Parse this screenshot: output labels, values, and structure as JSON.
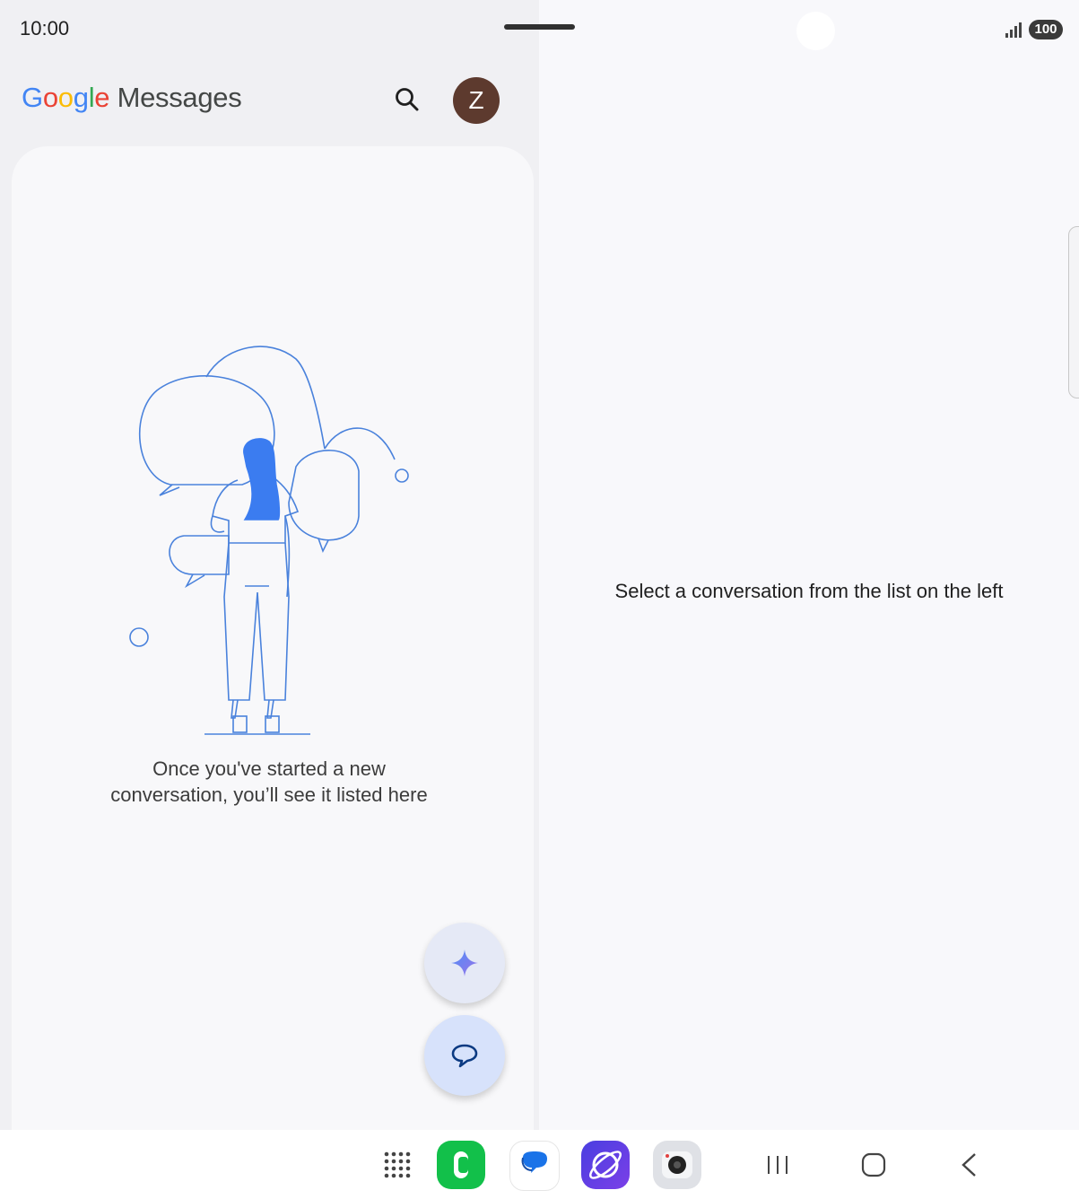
{
  "status_bar": {
    "time": "10:00",
    "battery": "100"
  },
  "header": {
    "logo_letters": [
      "G",
      "o",
      "o",
      "g",
      "l",
      "e"
    ],
    "logo_suffix": "Messages",
    "avatar_letter": "Z",
    "search_icon": "search-icon"
  },
  "conversation_list": {
    "empty_line1": "Once you've started a new",
    "empty_line2": "conversation, you’ll see it listed here"
  },
  "detail_pane": {
    "placeholder": "Select a conversation from the list on the left"
  },
  "fabs": {
    "gemini_icon": "gemini-sparkle-icon",
    "new_chat_icon": "new-chat-icon"
  },
  "taskbar": {
    "apps": [
      "app-drawer-icon",
      "phone-app-icon",
      "messages-app-icon",
      "internet-app-icon",
      "camera-app-icon"
    ],
    "nav": [
      "recents-icon",
      "home-icon",
      "back-icon"
    ]
  },
  "colors": {
    "illustration_stroke": "#4a82dc",
    "illustration_fill": "#3b7cf0",
    "avatar_bg": "#5d3a2e",
    "fab_bg": "#d7e2fb"
  }
}
